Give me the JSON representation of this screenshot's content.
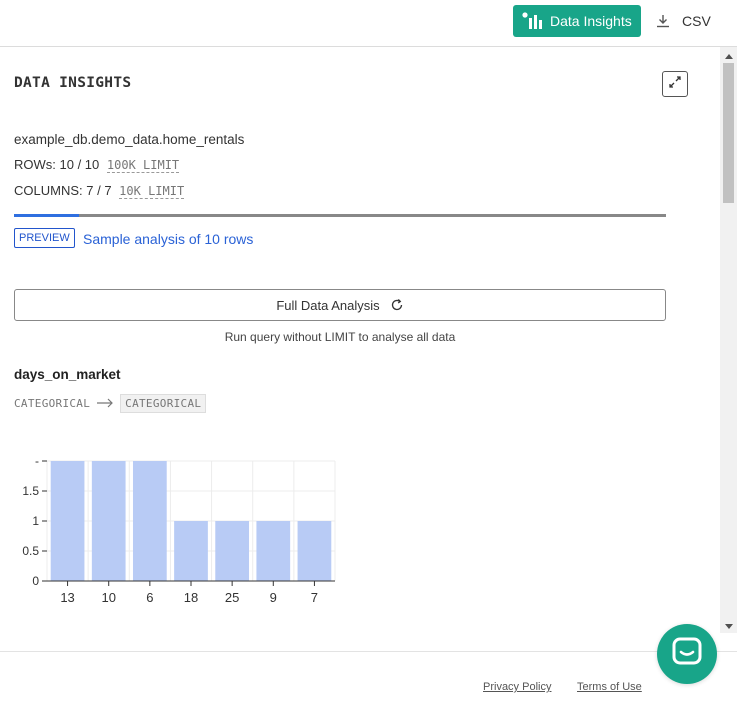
{
  "toolbar": {
    "insights_label": "Data Insights",
    "csv_label": "CSV"
  },
  "insights": {
    "title": "DATA INSIGHTS",
    "table_name": "example_db.demo_data.home_rentals",
    "rows_label": "ROWs:",
    "rows_value": "10 / 10",
    "rows_limit": "100K LIMIT",
    "columns_label": "COLUMNS:",
    "columns_value": "7 / 7",
    "columns_limit": "10K LIMIT",
    "progress_fraction": 0.1,
    "preview_badge": "PREVIEW",
    "sample_text": "Sample analysis of 10 rows",
    "full_analysis_label": "Full Data Analysis",
    "run_hint": "Run query without LIMIT to analyse all data"
  },
  "column": {
    "name": "days_on_market",
    "type_from": "CATEGORICAL",
    "type_to": "CATEGORICAL"
  },
  "chart_data": {
    "type": "bar",
    "categories": [
      "13",
      "10",
      "6",
      "18",
      "25",
      "9",
      "7"
    ],
    "values": [
      2,
      2,
      2,
      1,
      1,
      1,
      1
    ],
    "ylim": [
      0,
      2
    ],
    "yticks": [
      "0",
      "0.5",
      "1",
      "1.5",
      "-"
    ],
    "grid": true,
    "bar_color": "#b8cbf5"
  },
  "footer": {
    "privacy": "Privacy Policy",
    "terms": "Terms of Use"
  },
  "colors": {
    "accent": "#18a589",
    "link": "#2a62d6",
    "progress": "#2f6fe0"
  },
  "icons": {
    "insights": "bar-chart-icon",
    "csv": "download-icon",
    "expand": "expand-icon",
    "refresh": "refresh-icon",
    "arrow": "arrow-right-icon",
    "chat": "chat-icon"
  }
}
